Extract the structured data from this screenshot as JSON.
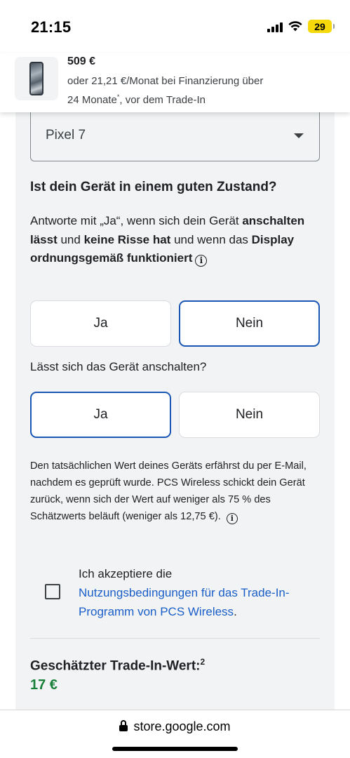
{
  "status_bar": {
    "time": "21:15",
    "battery": "29",
    "icons": [
      "signal-icon",
      "wifi-icon",
      "battery-icon"
    ]
  },
  "product": {
    "price": "509 €",
    "financing_line1": "oder 21,21 €/Monat bei Finanzierung über",
    "financing_line2_pre": "24 Monate",
    "financing_sup": "*",
    "financing_line2_post": ", vor dem Trade-In"
  },
  "device_select": {
    "value": "Pixel 7"
  },
  "condition": {
    "title": "Ist dein Gerät in einem guten Zustand?",
    "desc_1": "Antworte mit „Ja“, wenn sich dein Gerät ",
    "desc_bold_1": "anschalten lässt",
    "desc_2": " und ",
    "desc_bold_2": "keine Risse hat",
    "desc_3": " und wenn das ",
    "desc_bold_3": "Display ordnungsgemäß funktioniert",
    "yes_label": "Ja",
    "no_label": "Nein",
    "selected": "Nein"
  },
  "power_on": {
    "question": "Lässt sich das Gerät anschalten?",
    "yes_label": "Ja",
    "no_label": "Nein",
    "selected": "Ja"
  },
  "disclaimer": {
    "text": "Den tatsächlichen Wert deines Geräts erfährst du per E-Mail, nachdem es geprüft wurde. PCS Wireless schickt dein Gerät zurück, wenn sich der Wert auf weniger als 75 % des Schätzwerts beläuft (weniger als 12,75 €)."
  },
  "terms": {
    "prefix": "Ich akzeptiere die",
    "link": "Nutzungsbedingungen für das Trade-In-Programm von PCS Wireless",
    "suffix": ".",
    "checked": false
  },
  "estimate": {
    "label": "Geschätzter Trade-In-Wert:",
    "footnote": "2",
    "value": "17 €",
    "value_color": "#188038"
  },
  "browser": {
    "url": "store.google.com"
  },
  "colors": {
    "accent_blue": "#1a56b4",
    "link_blue": "#1a5ec8",
    "card_bg": "#f1f3f4"
  }
}
